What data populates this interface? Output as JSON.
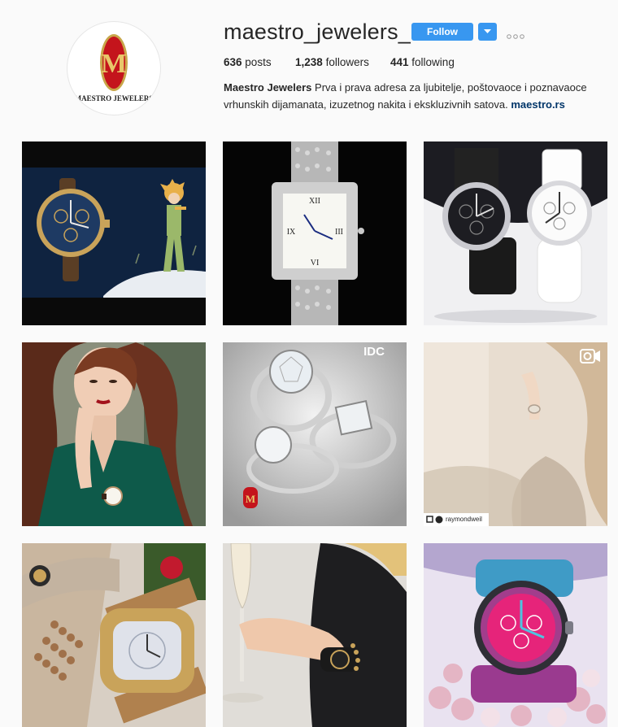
{
  "profile": {
    "username": "maestro_jewelers_",
    "follow_label": "Follow",
    "avatar_text": "MAESTRO JEWELERS",
    "avatar_letter": "M",
    "stats": {
      "posts_count": "636",
      "posts_label": "posts",
      "followers_count": "1,238",
      "followers_label": "followers",
      "following_count": "441",
      "following_label": "following"
    },
    "bio": {
      "full_name": "Maestro Jewelers",
      "text": " Prva i prava adresa za ljubitelje, poštovaoce i poznavaoce vrhunskih dijamanata, izuzetnog nakita i ekskluzivnih satova. ",
      "link": "maestro.rs"
    }
  },
  "grid": {
    "posts": [
      {
        "subject": "Blue dial gold watch with Little Prince illustration"
      },
      {
        "subject": "Diamond-set square watch on black"
      },
      {
        "subject": "Black and white chronograph watches"
      },
      {
        "subject": "Woman in green dress wearing watch"
      },
      {
        "subject": "Diamond engagement rings",
        "overlay_text": "IDC"
      },
      {
        "subject": "Woman touching hair, video",
        "repost_user": "raymondweil",
        "video": true
      },
      {
        "subject": "Beaded bracelets with gold watch"
      },
      {
        "subject": "Champagne glass and bracelet"
      },
      {
        "subject": "Pink dial watch with macarons"
      }
    ]
  },
  "colors": {
    "accent": "#3897f0",
    "link": "#003569",
    "text": "#262626",
    "background": "#fafafa"
  }
}
